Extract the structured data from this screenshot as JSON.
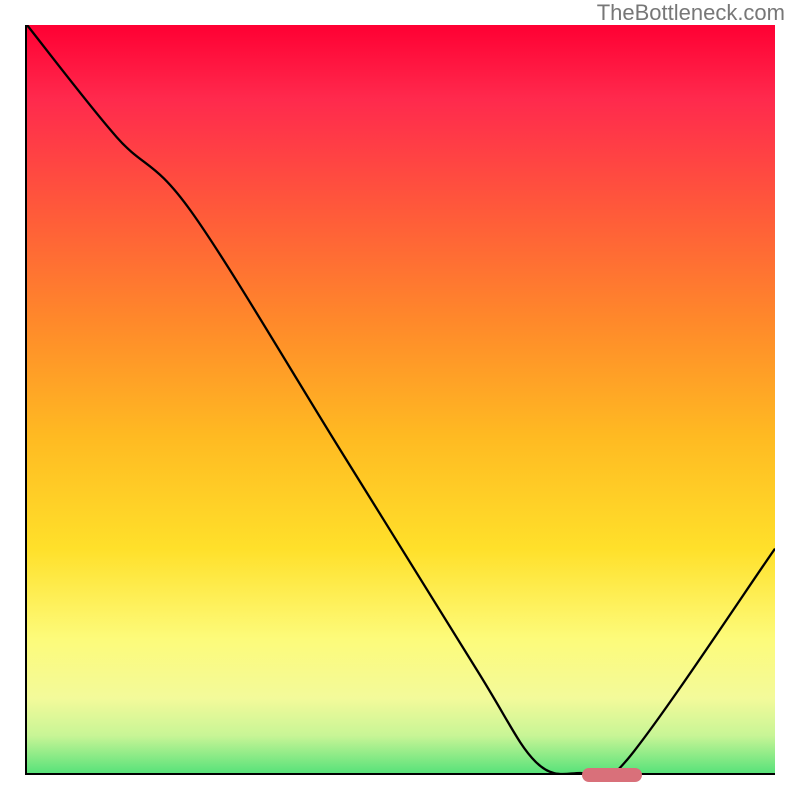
{
  "watermark": "TheBottleneck.com",
  "colors": {
    "grad_top": "#ff0033",
    "grad_bottom": "#58e27a",
    "curve": "#000000",
    "marker": "#d9707a",
    "axis": "#000000"
  },
  "chart_data": {
    "type": "line",
    "title": "",
    "xlabel": "",
    "ylabel": "",
    "xlim": [
      0,
      100
    ],
    "ylim": [
      0,
      100
    ],
    "series": [
      {
        "name": "curve",
        "x": [
          0,
          12,
          22,
          42,
          60,
          68,
          74,
          80,
          100
        ],
        "y": [
          100,
          85,
          75,
          43,
          14,
          1.5,
          0,
          1.5,
          30
        ]
      }
    ],
    "marker": {
      "x_start": 74,
      "x_end": 82,
      "y": 0
    }
  }
}
